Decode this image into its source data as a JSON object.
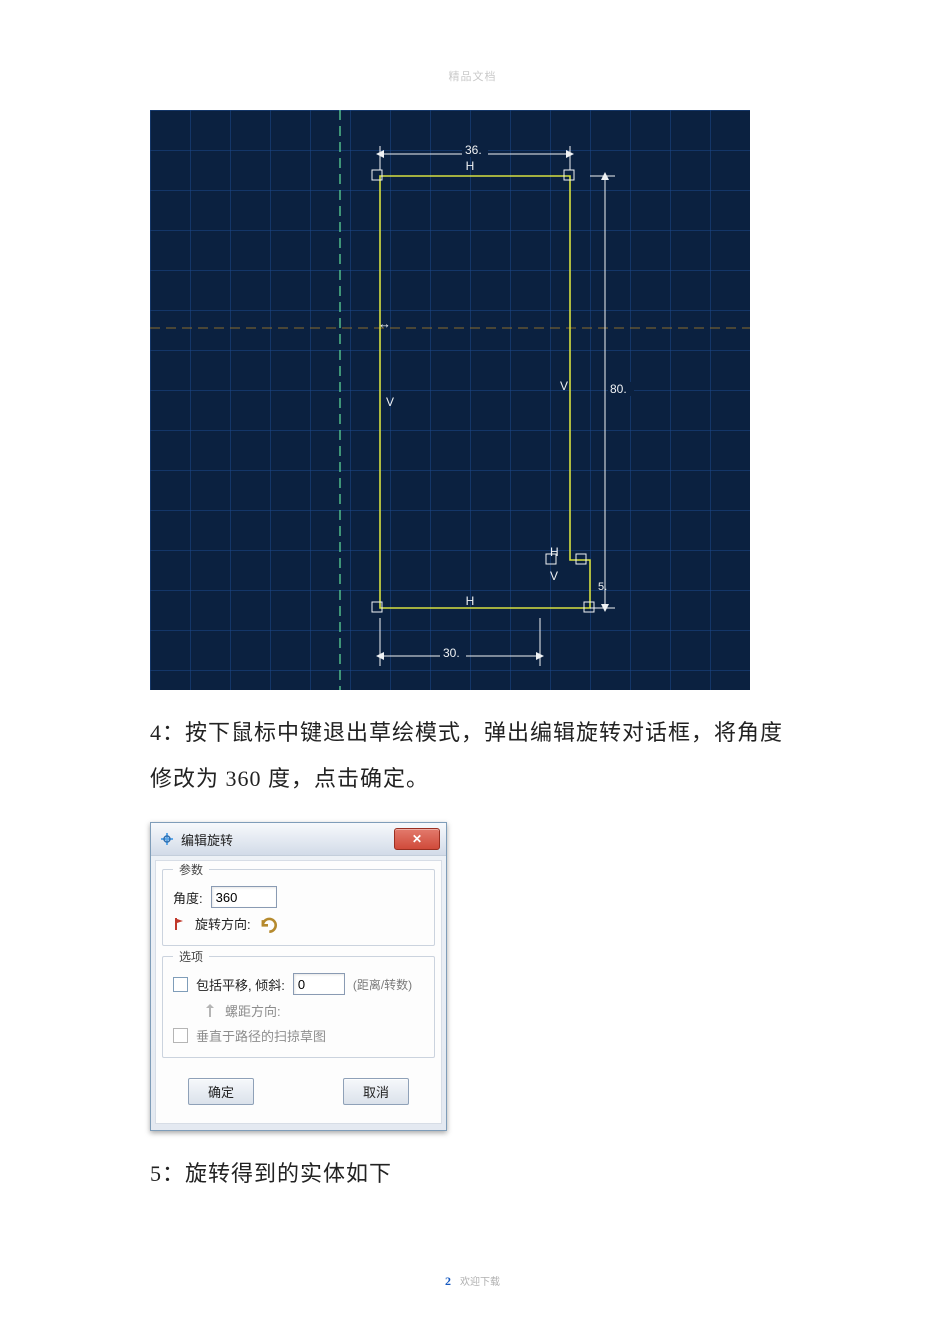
{
  "page": {
    "watermark": "精品文档",
    "page_number": "2",
    "footer_text": "欢迎下载"
  },
  "cad": {
    "dims": {
      "top_width": "36.",
      "bottom_width": "30.",
      "right_height": "80.",
      "step_small": "5."
    },
    "constraints": {
      "h": "H",
      "v": "V",
      "coincident": "⌖"
    }
  },
  "step4_text": "4：按下鼠标中键退出草绘模式，弹出编辑旋转对话框，将角度修改为 360 度，点击确定。",
  "dialog": {
    "title": "编辑旋转",
    "group_params": "参数",
    "angle_label": "角度:",
    "angle_value": "360",
    "rot_dir_label": "旋转方向:",
    "group_options": "选项",
    "include_translate_label": "包括平移, 倾斜:",
    "pitch_value": "0",
    "pitch_unit": "(距离/转数)",
    "pitch_dir_label": "螺距方向:",
    "perp_sweep_label": "垂直于路径的扫掠草图",
    "ok": "确定",
    "cancel": "取消"
  },
  "step5_text": "5：旋转得到的实体如下"
}
